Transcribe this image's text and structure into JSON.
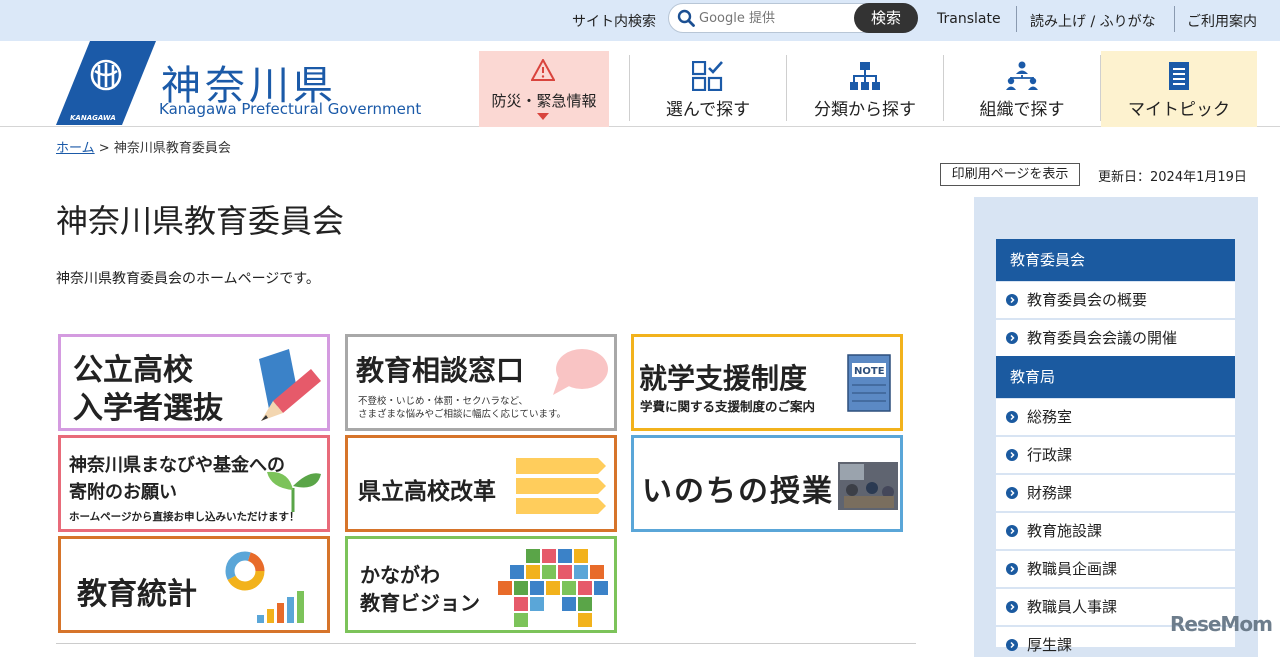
{
  "topbar": {
    "site_search_label": "サイト内検索",
    "search_placeholder": "Google 提供",
    "search_button": "検索",
    "links": [
      "Translate",
      "読み上げ / ふりがな",
      "ご利用案内"
    ]
  },
  "header": {
    "logo_title": "神奈川県",
    "logo_subtitle": "Kanagawa Prefectural Government",
    "logo_emblem_text": "KANAGAWA",
    "disaster_label": "防災・緊急情報",
    "nav": [
      "選んで探す",
      "分類から探す",
      "組織で探す",
      "マイトピック"
    ]
  },
  "breadcrumb": {
    "home": "ホーム",
    "separator": ">",
    "current": "神奈川県教育委員会"
  },
  "print_button": "印刷用ページを表示",
  "updated": "更新日：2024年1月19日",
  "page_title": "神奈川県教育委員会",
  "intro": "神奈川県教育委員会のホームページです。",
  "banners": {
    "admission": {
      "line1": "公立高校",
      "line2": "入学者選抜"
    },
    "consult": {
      "title": "教育相談窓口",
      "sub1": "不登校・いじめ・体罰・セクハラなど、",
      "sub2": "さまざまな悩みやご相談に幅広く応じています。"
    },
    "support": {
      "title": "就学支援制度",
      "sub": "学費に関する支援制度のご案内",
      "note": "NOTE"
    },
    "fund": {
      "line1": "神奈川県まなびや基金への",
      "line2": "寄附のお願い",
      "sub": "ホームページから直接お申し込みいただけます！"
    },
    "reform": {
      "title": "県立高校改革"
    },
    "life": {
      "title": "いのちの授業"
    },
    "stats": {
      "title": "教育統計"
    },
    "vision": {
      "line1": "かながわ",
      "line2": "教育ビジョン"
    }
  },
  "sidebar": {
    "group1_title": "教育委員会",
    "group1_items": [
      "教育委員会の概要",
      "教育委員会会議の開催"
    ],
    "group2_title": "教育局",
    "group2_items": [
      "総務室",
      "行政課",
      "財務課",
      "教育施設課",
      "教職員企画課",
      "教職員人事課",
      "厚生課"
    ]
  },
  "watermark": "ReseMom"
}
